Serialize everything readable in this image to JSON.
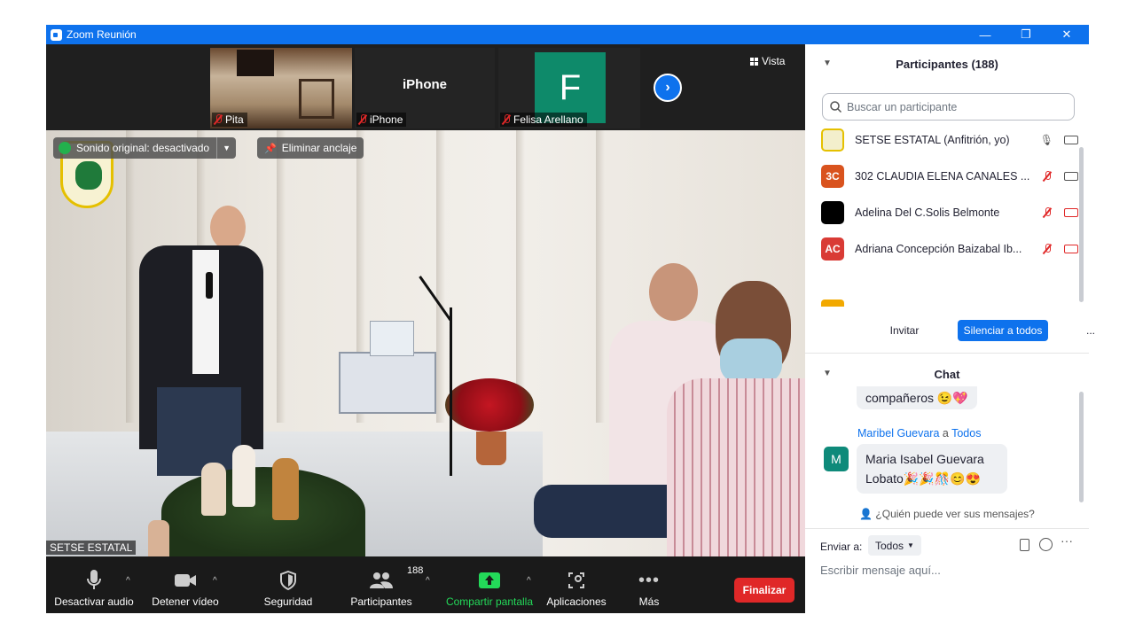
{
  "window": {
    "title": "Zoom Reunión",
    "minimize": "—",
    "restore": "❐",
    "close": "✕"
  },
  "strip": {
    "thumbs": [
      {
        "name": "Pita"
      },
      {
        "name": "iPhone",
        "label": "iPhone"
      },
      {
        "name": "Felisa Arellano",
        "initial": "F"
      }
    ],
    "view_label": "Vista"
  },
  "main_video": {
    "original_sound": "Sonido original: desactivado",
    "unpin": "Eliminar anclaje",
    "speaker_name": "SETSE ESTATAL"
  },
  "toolbar": {
    "audio": "Desactivar audio",
    "video": "Detener vídeo",
    "security": "Seguridad",
    "participants": "Participantes",
    "participants_count": "188",
    "share": "Compartir pantalla",
    "apps": "Aplicaciones",
    "more": "Más",
    "end": "Finalizar"
  },
  "participants_panel": {
    "title": "Participantes (188)",
    "search_placeholder": "Buscar un participante",
    "rows": [
      {
        "name": "SETSE ESTATAL (Anfitrión, yo)"
      },
      {
        "initials": "3C",
        "name": "302 CLAUDIA ELENA CANALES ..."
      },
      {
        "name": "Adelina Del C.Solis Belmonte"
      },
      {
        "initials": "AC",
        "name": "Adriana Concepción Baizabal Ib..."
      }
    ],
    "invite": "Invitar",
    "mute_all": "Silenciar a todos",
    "more": "..."
  },
  "chat": {
    "title": "Chat",
    "prev_message_tail": "compañeros 😉💖",
    "sender": "Maribel Guevara",
    "to_word": "a",
    "recipient": "Todos",
    "avatar_initial": "M",
    "message": "Maria Isabel Guevara Lobato🎉🎉🎊😊😍",
    "who_can_see": "¿Quién puede ver sus mensajes?",
    "send_to_label": "Enviar a:",
    "send_to_value": "Todos",
    "input_placeholder": "Escribir mensaje aquí..."
  },
  "colors": {
    "titlebar": "#0e72ed",
    "accent_blue": "#0e72ed",
    "end_red": "#e02828",
    "share_green": "#23d959",
    "chat_avatar": "#0e8a7a"
  }
}
